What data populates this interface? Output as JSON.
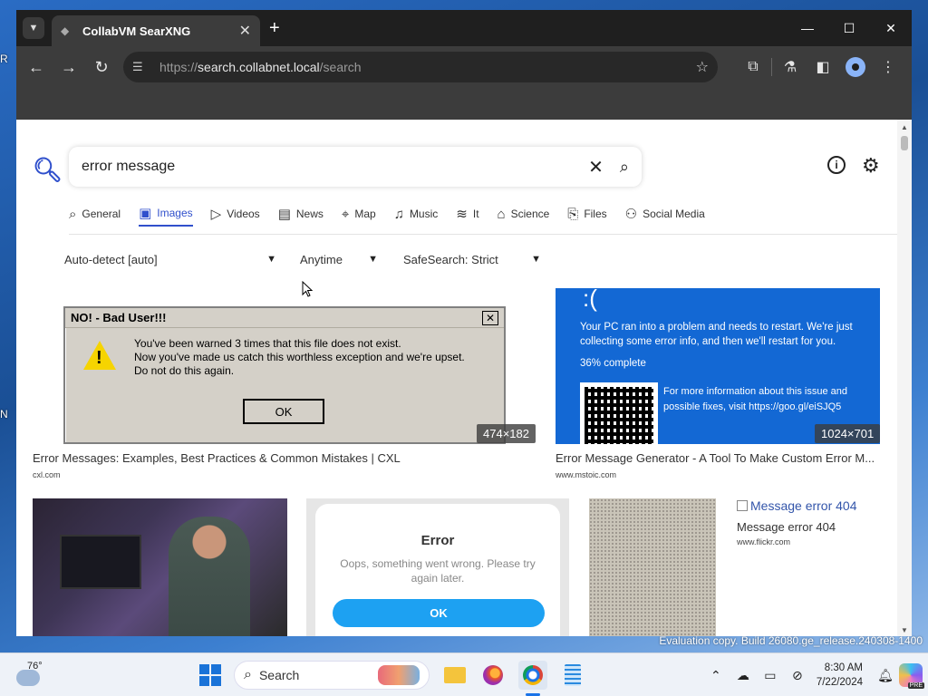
{
  "browser": {
    "tab_title": "CollabVM SearXNG",
    "url_protocol": "https://",
    "url_host": "search.collabnet.local",
    "url_path": "/search"
  },
  "search": {
    "query": "error message"
  },
  "categories": [
    {
      "label": "General",
      "icon": "search-icon"
    },
    {
      "label": "Images",
      "icon": "image-icon"
    },
    {
      "label": "Videos",
      "icon": "play-icon"
    },
    {
      "label": "News",
      "icon": "newspaper-icon"
    },
    {
      "label": "Map",
      "icon": "map-pin-icon"
    },
    {
      "label": "Music",
      "icon": "music-note-icon"
    },
    {
      "label": "It",
      "icon": "layers-icon"
    },
    {
      "label": "Science",
      "icon": "mortarboard-icon"
    },
    {
      "label": "Files",
      "icon": "files-icon"
    },
    {
      "label": "Social Media",
      "icon": "people-icon"
    }
  ],
  "active_category": "Images",
  "filters": {
    "language": "Auto-detect [auto]",
    "time": "Anytime",
    "safesearch": "SafeSearch: Strict"
  },
  "results": [
    {
      "title": "Error Messages: Examples, Best Practices & Common Mistakes | CXL",
      "domain": "cxl.com",
      "size": "474×182",
      "thumb": {
        "dialog_title": "NO! - Bad User!!!",
        "line1": "You've been warned 3 times that this file does not exist.",
        "line2": "Now you've made us catch this worthless exception and we're upset.",
        "line3": "Do not do this again.",
        "ok": "OK"
      }
    },
    {
      "title": "Error Message Generator - A Tool To Make Custom Error M...",
      "domain": "www.mstoic.com",
      "size": "1024×701",
      "thumb": {
        "face": ":(",
        "message": "Your PC ran into a problem and needs to restart. We're just collecting some error info, and then we'll restart for you.",
        "percent": "36% complete",
        "more": "For more information about this issue and possible fixes, visit https://goo.gl/eiSJQ5"
      }
    },
    {
      "thumb": {
        "title": "Error",
        "message": "Oops, something went wrong. Please try again later.",
        "ok": "OK"
      }
    },
    {
      "alt": "Message error 404",
      "title": "Message error 404",
      "domain": "www.flickr.com"
    }
  ],
  "desktop": {
    "watermark": "Evaluation copy. Build 26080.ge_release.240308-1400"
  },
  "taskbar": {
    "temperature": "76°",
    "search_placeholder": "Search",
    "time": "8:30 AM",
    "date": "7/22/2024"
  },
  "colors": {
    "accent": "#3050cc",
    "bsod": "#1368d4",
    "ok_button": "#1da1f2"
  }
}
